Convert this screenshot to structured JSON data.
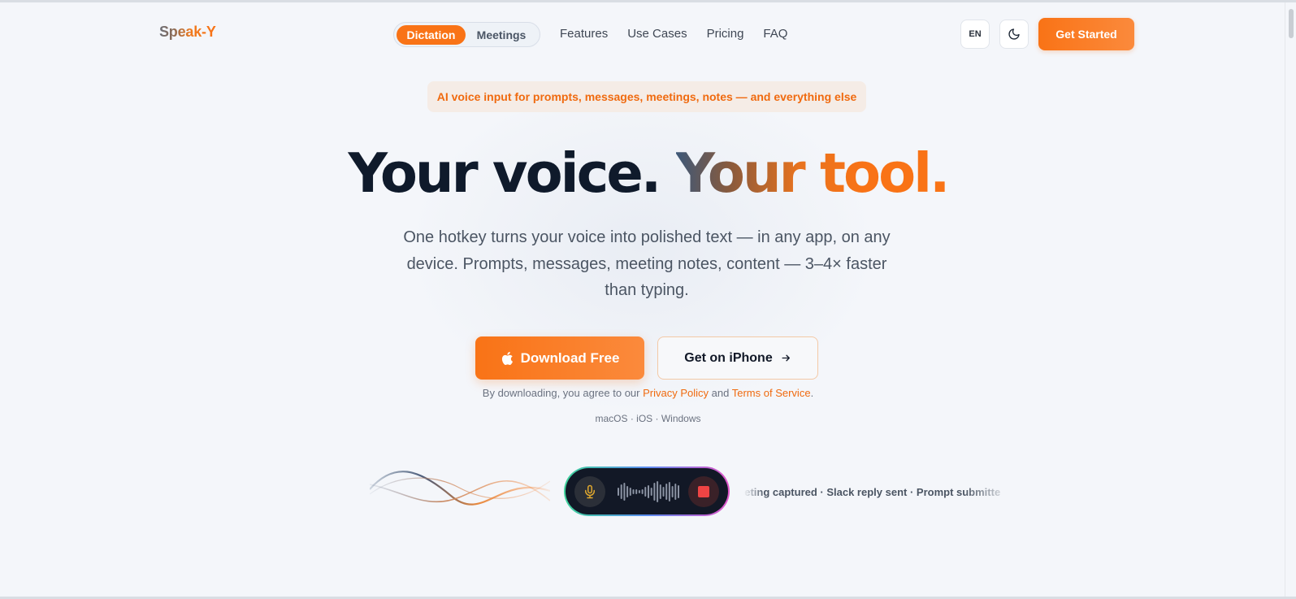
{
  "brand": {
    "logo": "Speak-Y"
  },
  "nav": {
    "modes": [
      "Dictation",
      "Meetings"
    ],
    "active_mode": "Dictation",
    "links": [
      "Features",
      "Use Cases",
      "Pricing",
      "FAQ"
    ],
    "language": "EN",
    "theme_icon": "moon-icon",
    "cta": "Get Started"
  },
  "hero": {
    "badge": "AI voice input for prompts, messages, meetings, notes — and everything else",
    "headline_dark": "Your voice.",
    "headline_accent": "Your tool.",
    "subtitle": "One hotkey turns your voice into polished text — in any app, on any device. Prompts, messages, meeting notes, content — 3–4× faster than typing.",
    "download_label": "Download Free",
    "download_icon": "apple-icon",
    "iphone_label": "Get on iPhone",
    "iphone_icon": "arrow-right-icon",
    "legal_prefix": "By downloading, you agree to our",
    "privacy_link": "Privacy Policy",
    "legal_and": "and",
    "terms_link": "Terms of Service",
    "legal_suffix": ".",
    "platforms": "macOS · iOS · Windows"
  },
  "demo": {
    "mic_icon": "microphone-icon",
    "stop_icon": "stop-icon",
    "ticker": "eeting captured · Slack reply sent · Prompt submitte"
  },
  "colors": {
    "accent": "#f97316",
    "dark_text": "#0f1a2b",
    "background": "#f4f6fa",
    "recorder_bg": "#121826",
    "stop_red": "#ef4444"
  }
}
